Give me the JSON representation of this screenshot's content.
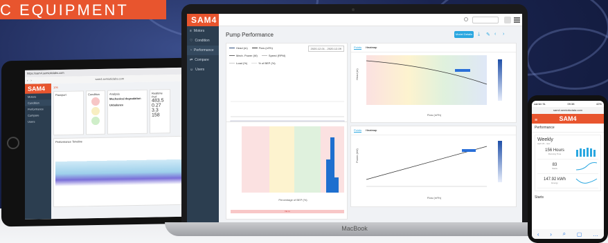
{
  "banner": {
    "text": "C EQUIPMENT"
  },
  "laptop": {
    "brand": "MacBook",
    "app_logo": "SAM4",
    "sidebar": [
      {
        "label": "Motors",
        "icon": "list-icon"
      },
      {
        "label": "Condition",
        "icon": "health-icon"
      },
      {
        "label": "Performance",
        "icon": "gauge-icon"
      },
      {
        "label": "Compare",
        "icon": "compare-icon"
      },
      {
        "label": "Users",
        "icon": "users-icon"
      }
    ],
    "page_title": "Pump Performance",
    "module_button": "Model Details",
    "legend": [
      "Head (m)",
      "Flow (m³/h)",
      "Mech. Power (W)",
      "Speed (RPM)",
      "Load (%)",
      "% of BEP (%)"
    ],
    "date_range": "2020-12-01 - 2020-12-09",
    "tabs_upper": [
      "Points",
      "Heatmap"
    ],
    "tabs_lower": [
      "Points",
      "Heatmap"
    ],
    "x_axis": "Flow (m³/h)",
    "y_head": "Head (m)",
    "y_power": "Power (kW)",
    "hist_x": "Percentage of BEP (%)",
    "anomaly": "No in"
  },
  "tablet": {
    "tab_title": "https://sam4.semioticlabs.com",
    "url": "sam4.semioticlabs.com",
    "app_logo": "SAM4",
    "sidebar": [
      "Motors",
      "Condition",
      "Performance",
      "Compare",
      "Users"
    ],
    "asset_id": "106",
    "passport": "Passport",
    "condition": "Condition",
    "analysis": "Analysis",
    "realtime": "Realtime Perf",
    "issue1": "Mechanical degradation",
    "issue2": "Unbalance",
    "kpi1": "483.5",
    "kpi2": "0.27",
    "kpi3": "3.3",
    "kpi4": "158",
    "timeline": "Performance Timeline"
  },
  "phone": {
    "carrier": "carrier 9L",
    "time": "09:38",
    "battery": "42%",
    "url": "sam4.semioticdata.com",
    "app_logo": "SAM4",
    "section": "Performance",
    "card_title": "Weekly",
    "card_sub": "April 23 - now",
    "metrics": [
      {
        "value": "156 Hours",
        "label": "Running Time"
      },
      {
        "value": "83",
        "label": "Starts"
      },
      {
        "value": "147.92 kWh",
        "label": "Energy"
      }
    ],
    "starts": "Starts"
  },
  "colors": {
    "brand": "#e8552e",
    "accent": "#2aa7e0",
    "sidebar": "#2c3e50"
  }
}
